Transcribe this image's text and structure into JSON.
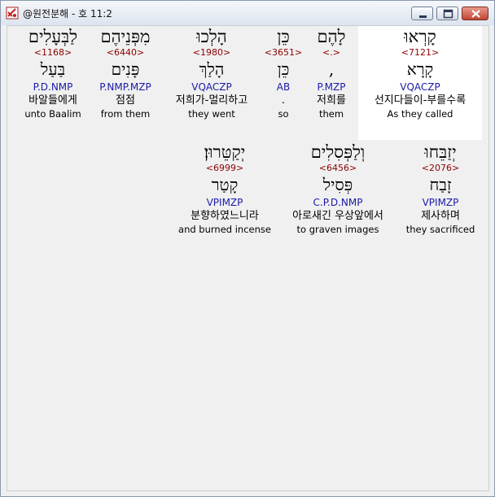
{
  "window": {
    "title": "@원전분해 - 호 11:2"
  },
  "rows": [
    {
      "words": [
        {
          "hebrew": "קָרְאוּ",
          "strong": "<7121>",
          "lemma": "קָרָא",
          "parse": "VQACZP",
          "korean": "선지다들이-부를수록",
          "english": "As they called",
          "highlight": true
        },
        {
          "hebrew": "לָהֶם",
          "strong": "<.>",
          "lemma": ",",
          "parse": "P.MZP",
          "korean": "저희를",
          "english": "them",
          "highlight": false
        },
        {
          "hebrew": "כֵּן",
          "strong": "<3651>",
          "lemma": "כֵּן",
          "parse": "AB",
          "korean": ".",
          "english": "so",
          "highlight": false
        },
        {
          "hebrew": "הָלְכוּ",
          "strong": "<1980>",
          "lemma": "הָלַךְ",
          "parse": "VQACZP",
          "korean": "저희가-멀리하고",
          "english": "they went",
          "highlight": false
        },
        {
          "hebrew": "מִפְּנֵיהֶם",
          "strong": "<6440>",
          "lemma": "פָּנִים",
          "parse": "P.NMP.MZP",
          "korean": "점점",
          "english": "from them",
          "highlight": false
        },
        {
          "hebrew": "לַבְּעָלִים",
          "strong": "<1168>",
          "lemma": "בַּעַל",
          "parse": "P.D.NMP",
          "korean": "바알들에게",
          "english": "unto Baalim",
          "highlight": false
        }
      ]
    },
    {
      "words": [
        {
          "hebrew": "יְזַבֵּחוּ",
          "strong": "<2076>",
          "lemma": "זָבַח",
          "parse": "VPIMZP",
          "korean": "제사하며",
          "english": "they sacrificed",
          "highlight": false
        },
        {
          "hebrew": "וְלַפְּסִלִים",
          "strong": "<6456>",
          "lemma": "פְּסִיל",
          "parse": "C.P.D.NMP",
          "korean": "아로새긴 우상앞에서",
          "english": "to graven images",
          "highlight": false
        },
        {
          "hebrew": "יְקַטֵּרוּן׃",
          "strong": "<6999>",
          "lemma": "קָטַר",
          "parse": "VPIMZP",
          "korean": "분향하였느니라",
          "english": "and burned incense",
          "highlight": false
        }
      ]
    }
  ]
}
